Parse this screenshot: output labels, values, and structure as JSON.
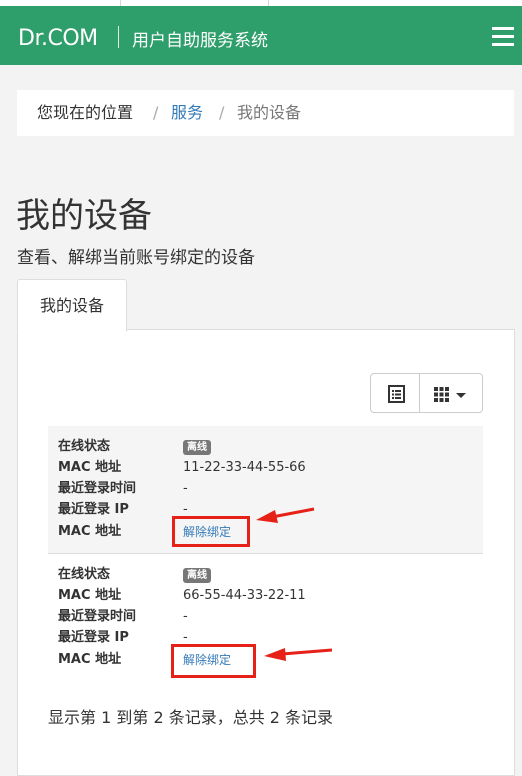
{
  "navbar": {
    "brand": "Dr.COM",
    "system_title": "用户自助服务系统",
    "menu_icon": "hamburger-menu-icon",
    "color": "#2e9e6b"
  },
  "breadcrumb": {
    "prefix": "您现在的位置",
    "separator": "/",
    "link": "服务",
    "current": "我的设备"
  },
  "page": {
    "title": "我的设备",
    "subtitle": "查看、解绑当前账号绑定的设备"
  },
  "tabs": [
    {
      "label": "我的设备",
      "active": true
    }
  ],
  "toolbar": {
    "list_view_icon": "list-view-icon",
    "grid_view_icon": "grid-view-icon",
    "dropdown_icon": "caret-down-icon"
  },
  "records": [
    {
      "status_label": "在线状态",
      "status_value": "离线",
      "mac_label": "MAC 地址",
      "mac_value": "11-22-33-44-55-66",
      "last_login_time_label": "最近登录时间",
      "last_login_time_value": "-",
      "last_login_ip_label": "最近登录 IP",
      "last_login_ip_value": "-",
      "action_label": "MAC 地址",
      "action_link": "解除绑定"
    },
    {
      "status_label": "在线状态",
      "status_value": "离线",
      "mac_label": "MAC 地址",
      "mac_value": "66-55-44-33-22-11",
      "last_login_time_label": "最近登录时间",
      "last_login_time_value": "-",
      "last_login_ip_label": "最近登录 IP",
      "last_login_ip_value": "-",
      "action_label": "MAC 地址",
      "action_link": "解除绑定"
    }
  ],
  "footer": {
    "summary": "显示第 1 到第 2 条记录，总共 2 条记录"
  },
  "colors": {
    "highlight": "#e62117",
    "link": "#337ab7"
  }
}
